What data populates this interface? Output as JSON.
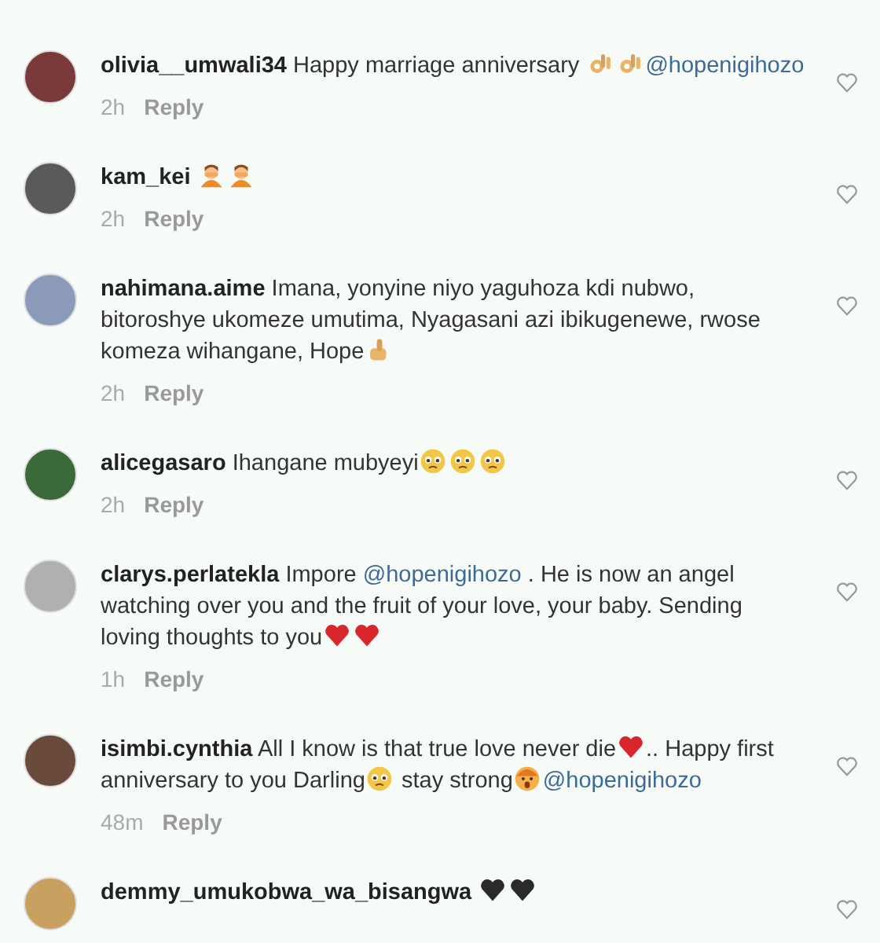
{
  "comments": [
    {
      "username": "olivia__umwali34",
      "time": "2h",
      "reply": "Reply",
      "liked": false,
      "parts": [
        {
          "kind": "text",
          "text": "Happy marriage anniversary "
        },
        {
          "kind": "okhand"
        },
        {
          "kind": "okhand"
        },
        {
          "kind": "mention",
          "text": "@hopenigihozo"
        }
      ]
    },
    {
      "username": "kam_kei",
      "time": "2h",
      "reply": "Reply",
      "liked": false,
      "parts": [
        {
          "kind": "facepalm"
        },
        {
          "kind": "facepalm"
        }
      ]
    },
    {
      "username": "nahimana.aime",
      "time": "2h",
      "reply": "Reply",
      "liked": false,
      "parts": [
        {
          "kind": "text",
          "text": "Imana, yonyine niyo yaguhoza kdi nubwo, bitoroshye ukomeze umutima, Nyagasani azi ibikugenewe, rwose komeza wihangane, Hope"
        },
        {
          "kind": "thumbsup"
        }
      ]
    },
    {
      "username": "alicegasaro",
      "time": "2h",
      "reply": "Reply",
      "liked": false,
      "parts": [
        {
          "kind": "text",
          "text": "Ihangane mubyeyi"
        },
        {
          "kind": "pleading"
        },
        {
          "kind": "pleading"
        },
        {
          "kind": "pleading"
        }
      ]
    },
    {
      "username": "clarys.perlatekla",
      "time": "1h",
      "reply": "Reply",
      "liked": false,
      "parts": [
        {
          "kind": "text",
          "text": "Impore "
        },
        {
          "kind": "mention",
          "text": "@hopenigihozo"
        },
        {
          "kind": "text",
          "text": " . He is now an angel watching over you and the fruit of your love, your baby. Sending loving thoughts to you"
        },
        {
          "kind": "heart"
        },
        {
          "kind": "heart"
        }
      ]
    },
    {
      "username": "isimbi.cynthia",
      "time": "48m",
      "reply": "Reply",
      "liked": false,
      "parts": [
        {
          "kind": "text",
          "text": "All I know is that true love never die"
        },
        {
          "kind": "heart"
        },
        {
          "kind": "text",
          "text": ".. Happy first anniversary to you Darling"
        },
        {
          "kind": "pleading"
        },
        {
          "kind": "text",
          "text": " stay strong"
        },
        {
          "kind": "astonished"
        },
        {
          "kind": "mention",
          "text": "@hopenigihozo"
        }
      ]
    },
    {
      "username": "demmy_umukobwa_wa_bisangwa",
      "liked": false,
      "parts": [
        {
          "kind": "blackheart"
        },
        {
          "kind": "blackheart"
        }
      ]
    }
  ]
}
